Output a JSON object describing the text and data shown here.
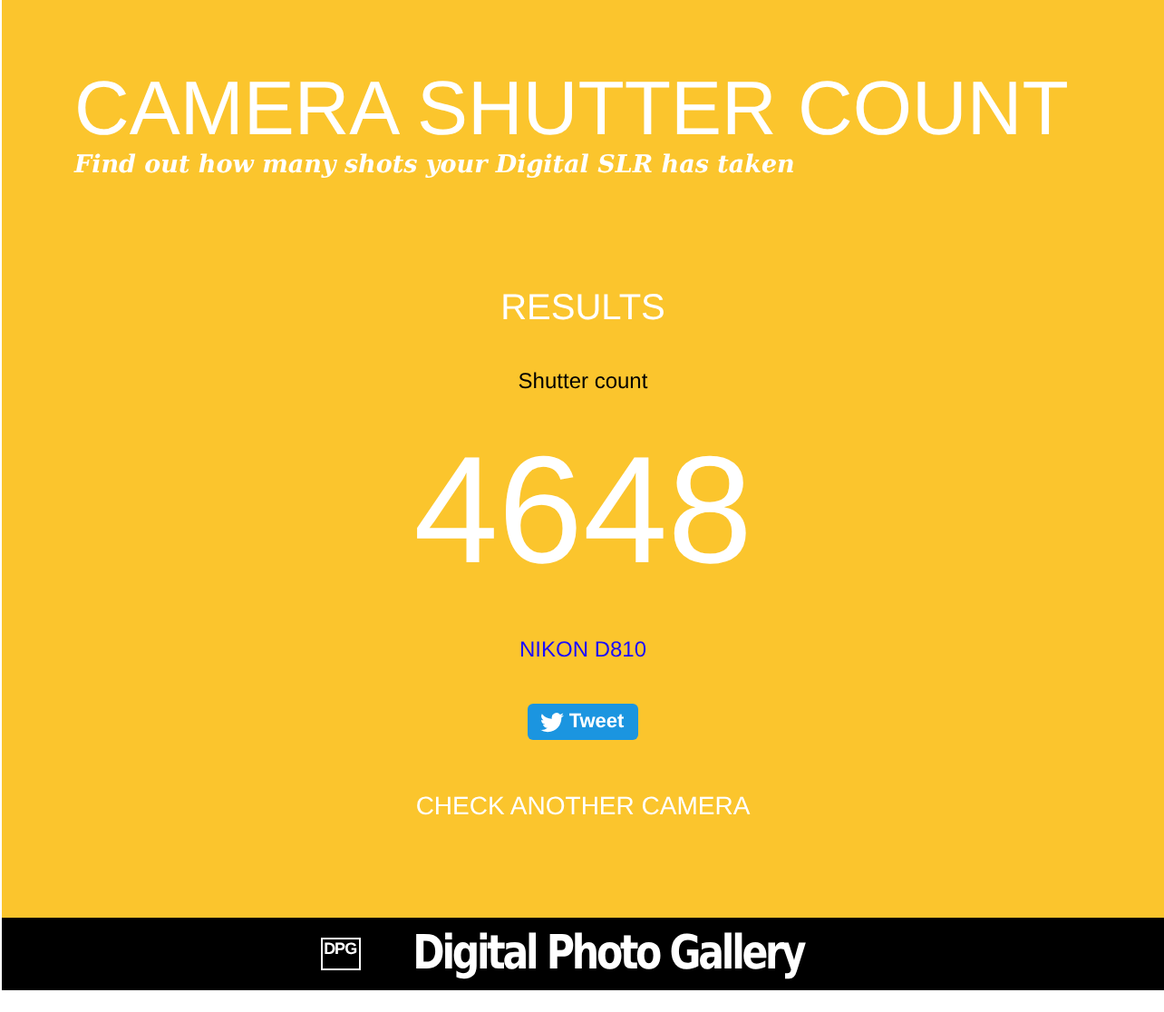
{
  "header": {
    "title": "CAMERA SHUTTER COUNT",
    "subtitle": "Find out how many shots your Digital SLR has taken"
  },
  "results": {
    "heading": "RESULTS",
    "label": "Shutter count",
    "count": "4648",
    "camera": "NIKON D810",
    "tweet": "Tweet",
    "check_again": "CHECK ANOTHER CAMERA"
  },
  "footer": {
    "logo_mark": "DPG",
    "brand": "Digital Photo Gallery"
  }
}
